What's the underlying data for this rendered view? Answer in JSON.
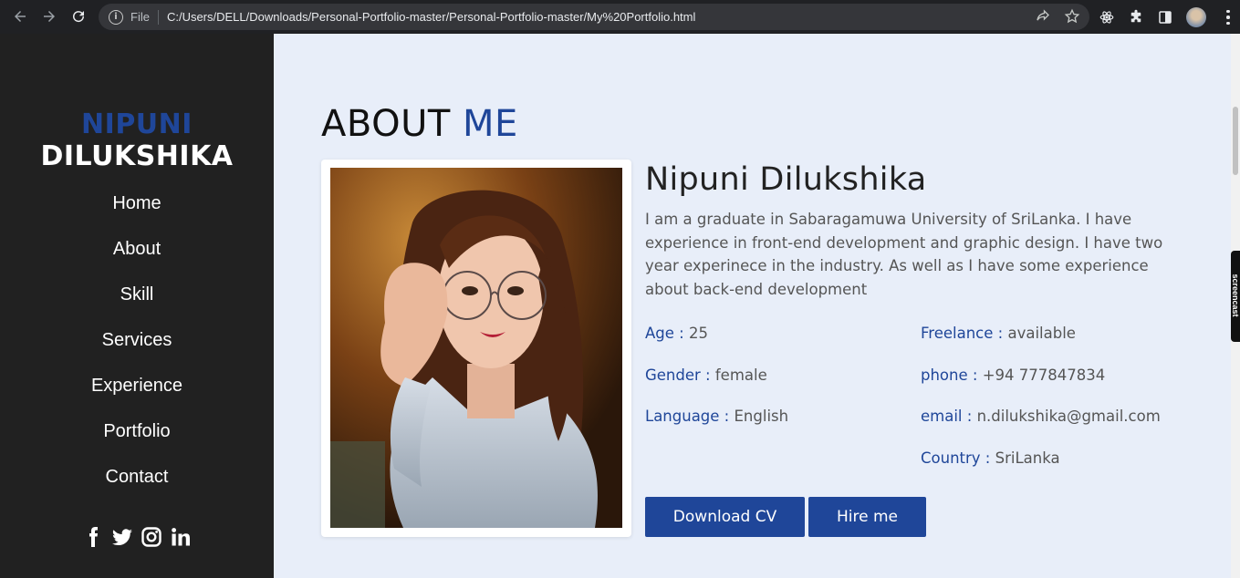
{
  "browser": {
    "file_label": "File",
    "url": "C:/Users/DELL/Downloads/Personal-Portfolio-master/Personal-Portfolio-master/My%20Portfolio.html"
  },
  "sidebar": {
    "brand_first": "NIPUNI",
    "brand_last": "DILUKSHIKA",
    "nav": [
      "Home",
      "About",
      "Skill",
      "Services",
      "Experience",
      "Portfolio",
      "Contact"
    ],
    "social_icons": [
      "facebook-icon",
      "twitter-icon",
      "instagram-icon",
      "linkedin-icon"
    ]
  },
  "about": {
    "title_main": "ABOUT",
    "title_accent": "ME",
    "name": "Nipuni Dilukshika",
    "bio": "I am a graduate in Sabaragamuwa University of SriLanka. I have experience in front-end development and graphic design. I have two year experinece in the industry. As well as I have some experience about back-end development",
    "details_left": [
      {
        "label": "Age",
        "value": "25"
      },
      {
        "label": "Gender",
        "value": "female"
      },
      {
        "label": "Language",
        "value": "English"
      }
    ],
    "details_right": [
      {
        "label": "Freelance",
        "value": "available"
      },
      {
        "label": "phone",
        "value": "+94 777847834"
      },
      {
        "label": "email",
        "value": "n.dilukshika@gmail.com"
      },
      {
        "label": "Country",
        "value": "SriLanka"
      }
    ],
    "separator": " : ",
    "download_label": "Download CV",
    "hire_label": "Hire me"
  },
  "extension_tab": "screencast",
  "colors": {
    "accent": "#1f4699",
    "sidebar_bg": "#212121",
    "main_bg": "#e8eef9"
  }
}
